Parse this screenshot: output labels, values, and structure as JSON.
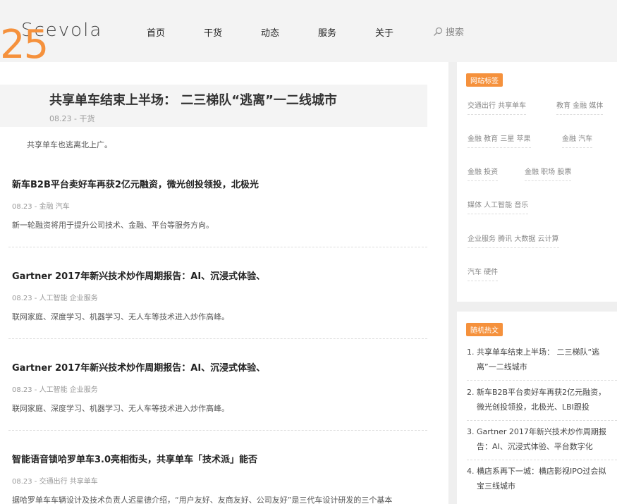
{
  "header": {
    "logo": "Scevola",
    "nav": [
      "首页",
      "干货",
      "动态",
      "服务",
      "关于"
    ],
    "search_label": "搜索"
  },
  "featured": {
    "day": "25",
    "title": "共享单车结束上半场： 二三梯队“逃离”一二线城市",
    "meta": "08.23 - 干货",
    "summary": "共享单车也逃离北上广。"
  },
  "articles": [
    {
      "title": "新车B2B平台卖好车再获2亿元融资，微光创投领投，北极光",
      "meta": "08.23 - 金融 汽车",
      "summary": "新一轮融资将用于提升公司技术、金融、平台等服务方向。"
    },
    {
      "title": "Gartner 2017年新兴技术炒作周期报告：AI、沉浸式体验、",
      "meta": "08.23 - 人工智能 企业服务",
      "summary": "联网家庭、深度学习、机器学习、无人车等技术进入炒作高峰。"
    },
    {
      "title": "Gartner 2017年新兴技术炒作周期报告：AI、沉浸式体验、",
      "meta": "08.23 - 人工智能 企业服务",
      "summary": "联网家庭、深度学习、机器学习、无人车等技术进入炒作高峰。"
    },
    {
      "title": "智能语音锁哈罗单车3.0亮相街头，共享单车「技术派」能否",
      "meta": "08.23 - 交通出行 共享单车",
      "summary": "据哈罗单车车辆设计及技术负责人迟星德介绍，“用户友好、友商友好、公司友好”是三代车设计研发的三个基本"
    }
  ],
  "sidebar": {
    "tags_title": "网站标签",
    "tag_groups": [
      "交通出行 共享单车",
      "教育 金融 媒体",
      "金融 教育 三星 苹果",
      "金融 汽车",
      "金融 投资",
      "金融 职场 股票",
      "媒体 人工智能 音乐",
      "企业服务 腾讯 大数据 云计算",
      "汽车 硬件"
    ],
    "hot_title": "随机热文",
    "hot_posts": [
      {
        "line1": "1. 共享单车结束上半场： 二三梯队“逃",
        "line2": "离”一二线城市"
      },
      {
        "line1": "2. 新车B2B平台卖好车再获2亿元融资，",
        "line2": "微光创投领投，北极光、LBI跟投"
      },
      {
        "line1": "3. Gartner 2017年新兴技术炒作周期报",
        "line2": "告：AI、沉浸式体验、平台数字化"
      },
      {
        "line1": "4. 横店系再下一城：横店影视IPO过会拟",
        "line2": "宝三线城市"
      }
    ]
  }
}
